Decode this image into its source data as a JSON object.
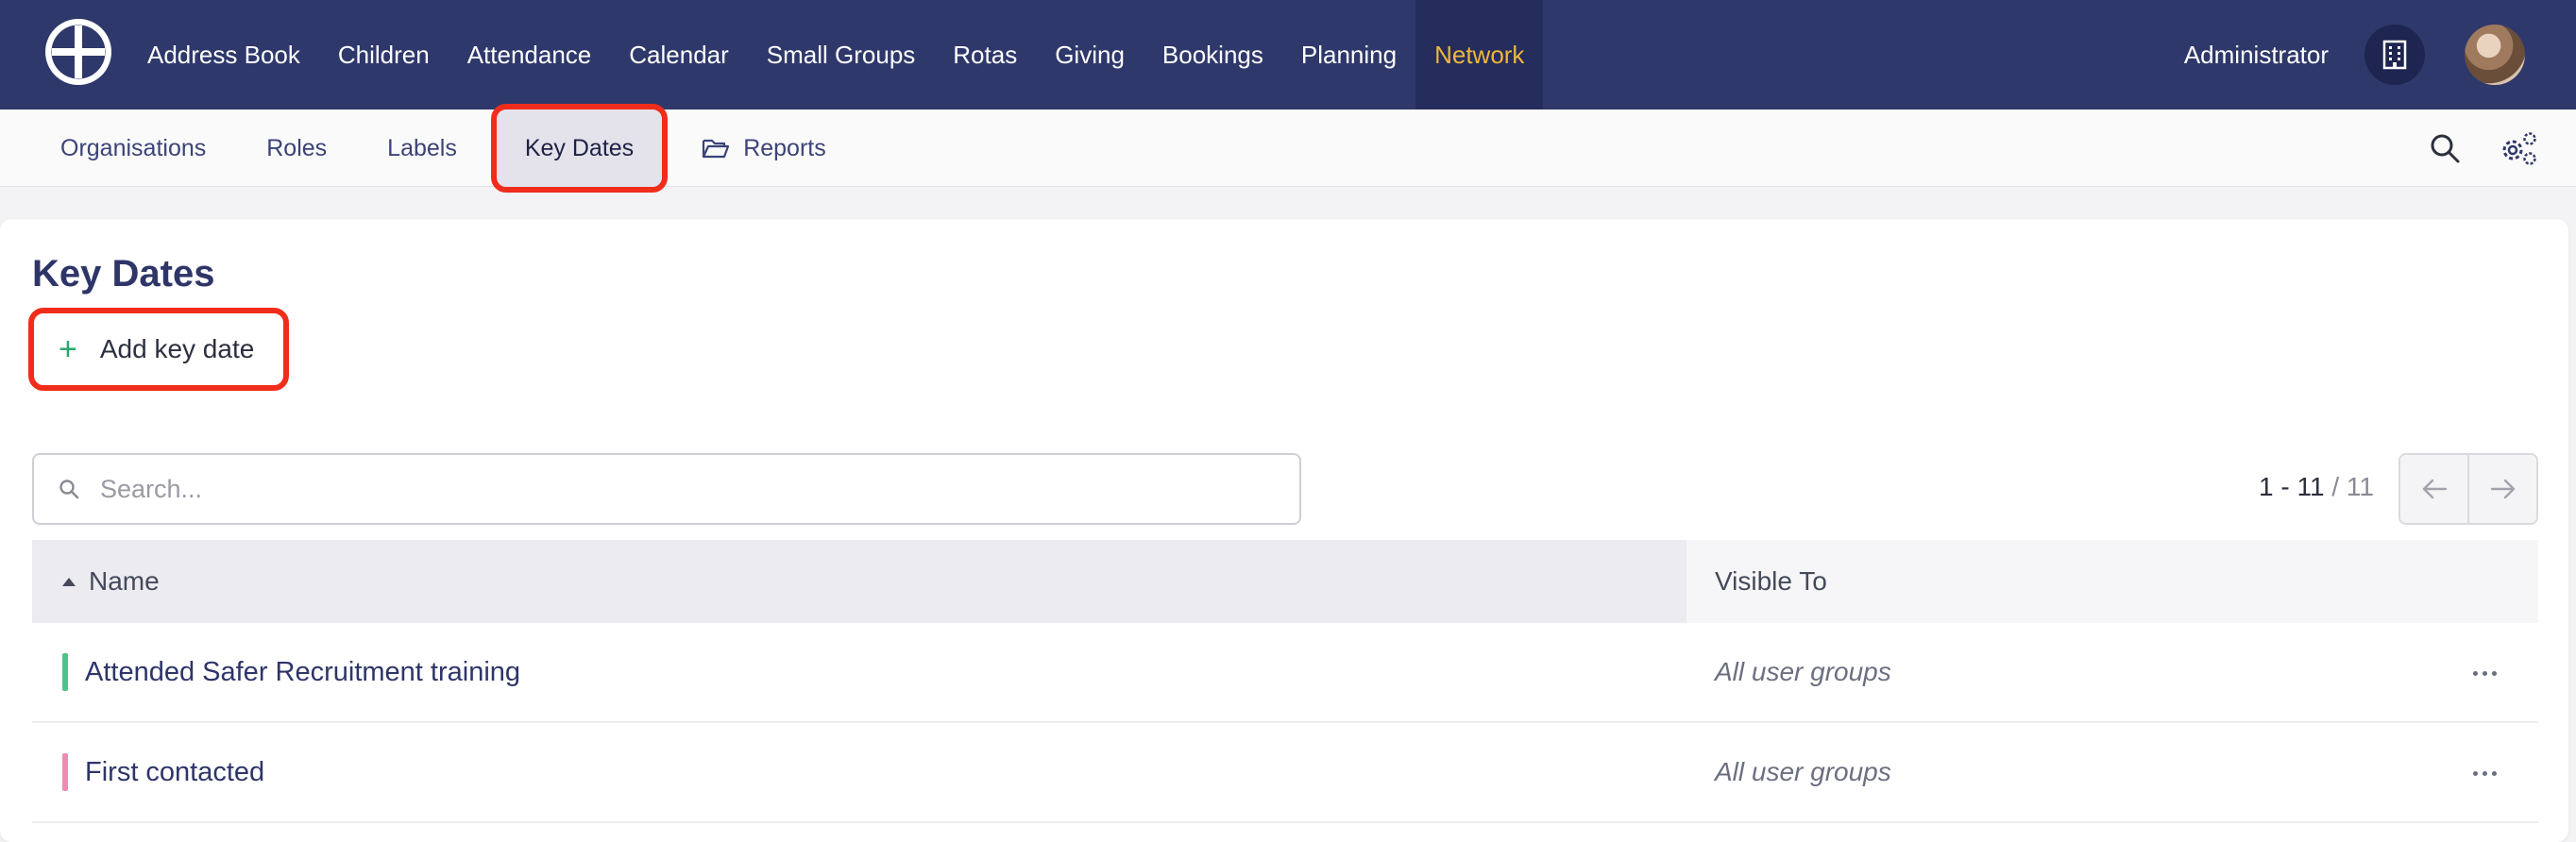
{
  "topnav": {
    "items": [
      "Address Book",
      "Children",
      "Attendance",
      "Calendar",
      "Small Groups",
      "Rotas",
      "Giving",
      "Bookings",
      "Planning",
      "Network"
    ],
    "active": "Network",
    "user_label": "Administrator",
    "icons": {
      "logo": "logo-icon",
      "org": "building-icon",
      "avatar": "avatar"
    }
  },
  "subnav": {
    "items": [
      "Organisations",
      "Roles",
      "Labels",
      "Key Dates",
      "Reports"
    ],
    "active": "Key Dates",
    "icons": {
      "reports": "folder-open-icon",
      "search": "search-icon",
      "settings": "gears-icon"
    }
  },
  "page": {
    "title": "Key Dates",
    "add_button_label": "Add key date",
    "search_placeholder": "Search..."
  },
  "pager": {
    "range": "1 - 11",
    "total": "/ 11"
  },
  "table": {
    "columns": [
      "Name",
      "Visible To"
    ],
    "sort": {
      "column": "Name",
      "direction": "ascending"
    },
    "rows": [
      {
        "name": "Attended Safer Recruitment training",
        "visible_to": "All user groups",
        "color": "#4fc48a"
      },
      {
        "name": "First contacted",
        "visible_to": "All user groups",
        "color": "#f08bb4"
      }
    ]
  },
  "colors": {
    "topbar": "#2f386b",
    "active_nav_text": "#f0b63a",
    "highlight": "#f02d1a",
    "add_icon": "#2aa86b"
  }
}
